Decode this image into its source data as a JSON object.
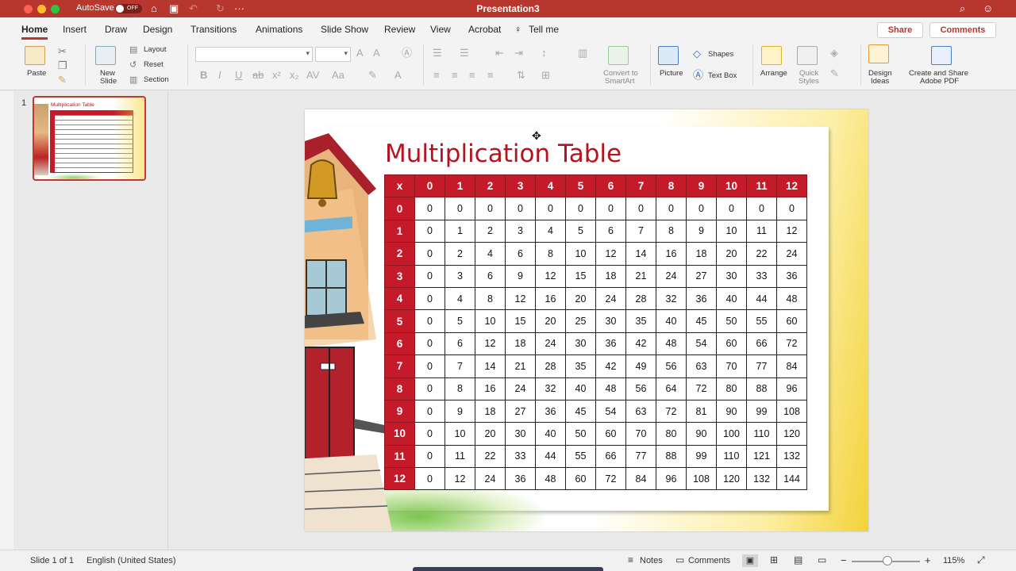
{
  "titlebar": {
    "autosave_label": "AutoSave",
    "autosave_state": "OFF",
    "document_title": "Presentation3",
    "more_icon": "ellipsis-icon"
  },
  "tabs": [
    "Home",
    "Insert",
    "Draw",
    "Design",
    "Transitions",
    "Animations",
    "Slide Show",
    "Review",
    "View",
    "Acrobat"
  ],
  "tell_me": "Tell me",
  "share_label": "Share",
  "comments_label": "Comments",
  "ribbon": {
    "paste": "Paste",
    "new_slide_1": "New",
    "new_slide_2": "Slide",
    "layout": "Layout",
    "reset": "Reset",
    "section": "Section",
    "convert_1": "Convert to",
    "convert_2": "SmartArt",
    "picture": "Picture",
    "shapes": "Shapes",
    "text_box": "Text Box",
    "arrange": "Arrange",
    "quick_styles_1": "Quick",
    "quick_styles_2": "Styles",
    "design_ideas_1": "Design",
    "design_ideas_2": "Ideas",
    "adobe_1": "Create and Share",
    "adobe_2": "Adobe PDF"
  },
  "thumbnail": {
    "number": "1",
    "title": "Multiplication Table"
  },
  "slide": {
    "title": "Multiplication Table",
    "header_corner": "x",
    "columns": [
      "0",
      "1",
      "2",
      "3",
      "4",
      "5",
      "6",
      "7",
      "8",
      "9",
      "10",
      "11",
      "12"
    ],
    "rows": [
      {
        "label": "0",
        "cells": [
          "0",
          "0",
          "0",
          "0",
          "0",
          "0",
          "0",
          "0",
          "0",
          "0",
          "0",
          "0",
          "0"
        ]
      },
      {
        "label": "1",
        "cells": [
          "0",
          "1",
          "2",
          "3",
          "4",
          "5",
          "6",
          "7",
          "8",
          "9",
          "10",
          "11",
          "12"
        ]
      },
      {
        "label": "2",
        "cells": [
          "0",
          "2",
          "4",
          "6",
          "8",
          "10",
          "12",
          "14",
          "16",
          "18",
          "20",
          "22",
          "24"
        ]
      },
      {
        "label": "3",
        "cells": [
          "0",
          "3",
          "6",
          "9",
          "12",
          "15",
          "18",
          "21",
          "24",
          "27",
          "30",
          "33",
          "36"
        ]
      },
      {
        "label": "4",
        "cells": [
          "0",
          "4",
          "8",
          "12",
          "16",
          "20",
          "24",
          "28",
          "32",
          "36",
          "40",
          "44",
          "48"
        ]
      },
      {
        "label": "5",
        "cells": [
          "0",
          "5",
          "10",
          "15",
          "20",
          "25",
          "30",
          "35",
          "40",
          "45",
          "50",
          "55",
          "60"
        ]
      },
      {
        "label": "6",
        "cells": [
          "0",
          "6",
          "12",
          "18",
          "24",
          "30",
          "36",
          "42",
          "48",
          "54",
          "60",
          "66",
          "72"
        ]
      },
      {
        "label": "7",
        "cells": [
          "0",
          "7",
          "14",
          "21",
          "28",
          "35",
          "42",
          "49",
          "56",
          "63",
          "70",
          "77",
          "84"
        ]
      },
      {
        "label": "8",
        "cells": [
          "0",
          "8",
          "16",
          "24",
          "32",
          "40",
          "48",
          "56",
          "64",
          "72",
          "80",
          "88",
          "96"
        ]
      },
      {
        "label": "9",
        "cells": [
          "0",
          "9",
          "18",
          "27",
          "36",
          "45",
          "54",
          "63",
          "72",
          "81",
          "90",
          "99",
          "108"
        ]
      },
      {
        "label": "10",
        "cells": [
          "0",
          "10",
          "20",
          "30",
          "40",
          "50",
          "60",
          "70",
          "80",
          "90",
          "100",
          "110",
          "120"
        ]
      },
      {
        "label": "11",
        "cells": [
          "0",
          "11",
          "22",
          "33",
          "44",
          "55",
          "66",
          "77",
          "88",
          "99",
          "110",
          "121",
          "132"
        ]
      },
      {
        "label": "12",
        "cells": [
          "0",
          "12",
          "24",
          "36",
          "48",
          "60",
          "72",
          "84",
          "96",
          "108",
          "120",
          "132",
          "144"
        ]
      }
    ]
  },
  "status": {
    "slide_of": "Slide 1 of 1",
    "language": "English (United States)",
    "notes": "Notes",
    "comments": "Comments",
    "zoom": "115%"
  },
  "colors": {
    "accent": "#b7372e",
    "table_header": "#c41a29"
  }
}
